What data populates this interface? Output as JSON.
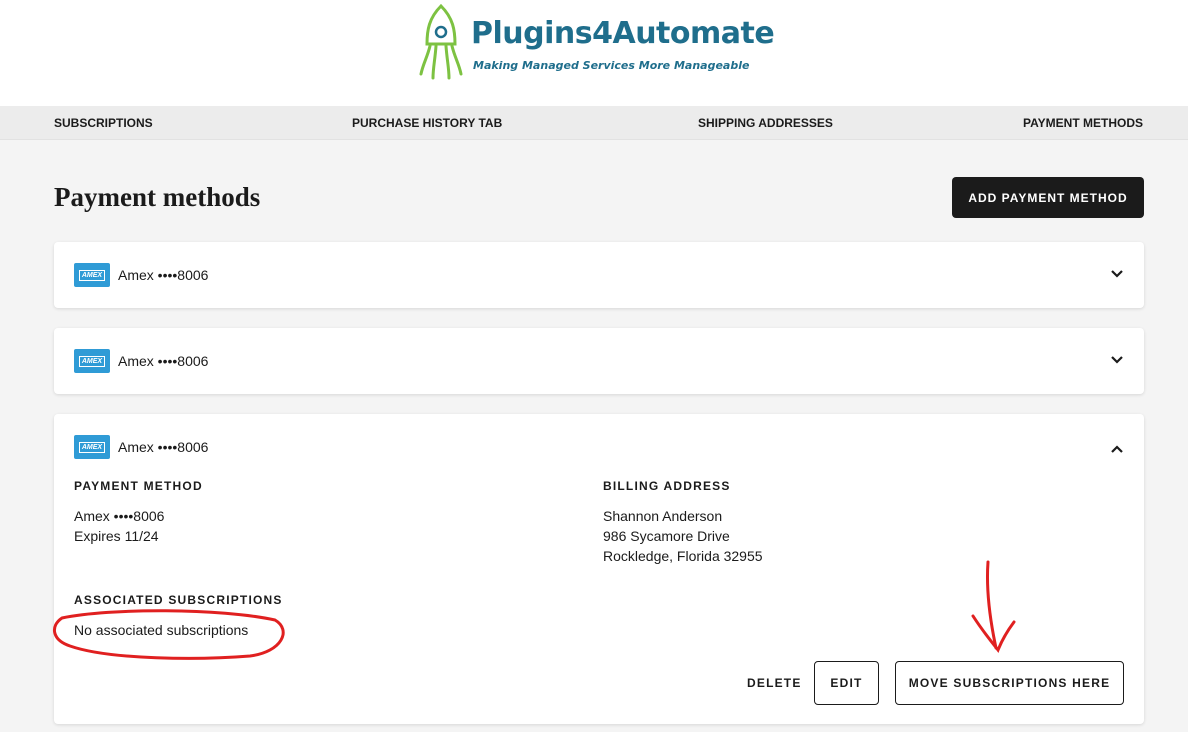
{
  "brand": {
    "name": "Plugins4Automate",
    "tagline": "Making Managed Services More Manageable",
    "colors": {
      "green": "#7dc242",
      "blue": "#1f6e8c"
    }
  },
  "nav": {
    "subscriptions": "SUBSCRIPTIONS",
    "purchase_history": "PURCHASE HISTORY TAB",
    "shipping_addresses": "SHIPPING ADDRESSES",
    "payment_methods": "PAYMENT METHODS"
  },
  "page": {
    "title": "Payment methods",
    "add_button": "ADD PAYMENT METHOD"
  },
  "cards": [
    {
      "brand_icon": "amex-card-icon",
      "brand_mark": "AMEX",
      "label": "Amex ••••8006",
      "expanded": false
    },
    {
      "brand_icon": "amex-card-icon",
      "brand_mark": "AMEX",
      "label": "Amex ••••8006",
      "expanded": false
    },
    {
      "brand_icon": "amex-card-icon",
      "brand_mark": "AMEX",
      "label": "Amex ••••8006",
      "expanded": true,
      "payment_method_label": "PAYMENT METHOD",
      "payment_line1": "Amex ••••8006",
      "payment_line2": "Expires 11/24",
      "billing_label": "BILLING ADDRESS",
      "billing_name": "Shannon Anderson",
      "billing_street": "986 Sycamore Drive",
      "billing_city": "Rockledge, Florida 32955",
      "subs_label": "ASSOCIATED SUBSCRIPTIONS",
      "subs_value": "No associated subscriptions",
      "delete": "DELETE",
      "edit": "EDIT",
      "move": "MOVE SUBSCRIPTIONS HERE"
    }
  ],
  "annotations": {
    "color": "#e02020",
    "shapes": [
      "circle-around-no-subscriptions",
      "arrow-pointing-to-move-button"
    ]
  },
  "colors": {
    "accent_dark": "#1b1b1b",
    "amex_blue": "#2f9bd6",
    "page_bg": "#f4f4f4"
  }
}
